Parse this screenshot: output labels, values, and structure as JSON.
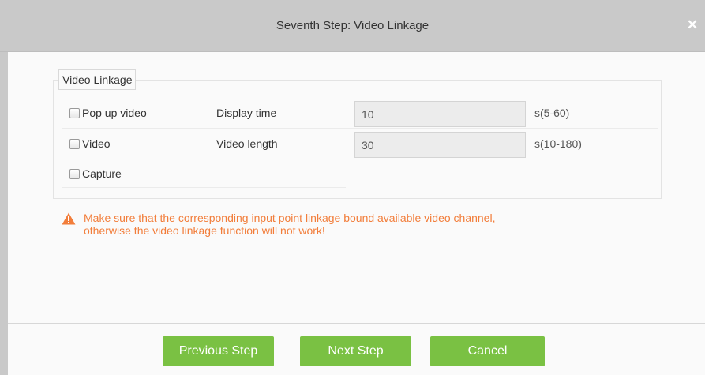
{
  "dialog": {
    "title": "Seventh Step: Video Linkage",
    "close_icon": "close-icon"
  },
  "fieldset": {
    "legend": "Video Linkage",
    "rows": [
      {
        "checkbox_label": "Pop up video",
        "checked": false,
        "field_label": "Display time",
        "value": "10",
        "range": "s(5-60)"
      },
      {
        "checkbox_label": "Video",
        "checked": false,
        "field_label": "Video length",
        "value": "30",
        "range": "s(10-180)"
      },
      {
        "checkbox_label": "Capture",
        "checked": false
      }
    ]
  },
  "warning": {
    "icon": "warning-triangle-icon",
    "line1": "Make sure that the corresponding input point linkage bound available video channel,",
    "line2": "otherwise the video linkage function will not work!"
  },
  "buttons": {
    "previous": "Previous Step",
    "next": "Next Step",
    "cancel": "Cancel"
  },
  "colors": {
    "accent_green": "#7ac143",
    "warning_orange": "#f27d3a",
    "titlebar_gray": "#c9c9c9"
  }
}
